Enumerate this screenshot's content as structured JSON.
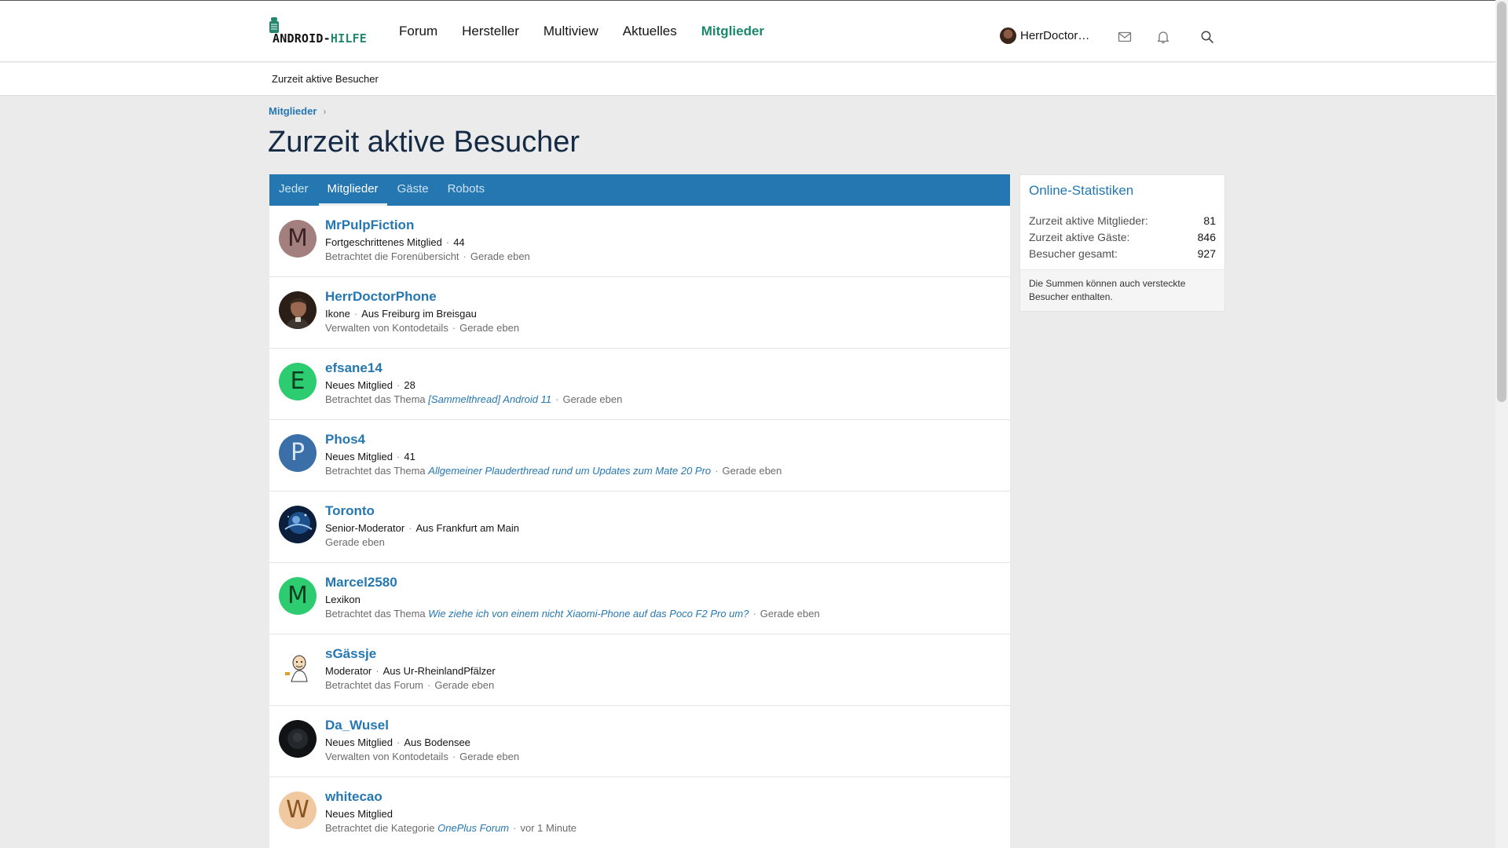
{
  "header": {
    "logo_text_main": "ANDROID-",
    "logo_text_accent": "HILFE",
    "nav": [
      {
        "label": "Forum",
        "active": false
      },
      {
        "label": "Hersteller",
        "active": false
      },
      {
        "label": "Multiview",
        "active": false
      },
      {
        "label": "Aktuelles",
        "active": false
      },
      {
        "label": "Mitglieder",
        "active": true
      }
    ],
    "user_name": "HerrDoctor…",
    "icons": [
      "mail-icon",
      "bell-icon",
      "search-icon"
    ]
  },
  "subnav": {
    "item": "Zurzeit aktive Besucher"
  },
  "breadcrumb": {
    "item": "Mitglieder",
    "separator": "›"
  },
  "page": {
    "title": "Zurzeit aktive Besucher"
  },
  "tabs": [
    {
      "label": "Jeder",
      "active": false
    },
    {
      "label": "Mitglieder",
      "active": true
    },
    {
      "label": "Gäste",
      "active": false
    },
    {
      "label": "Robots",
      "active": false
    }
  ],
  "members": [
    {
      "name": "MrPulpFiction",
      "avatar_type": "letter",
      "letter": "M",
      "avatar_bg": "#a37f7f",
      "avatar_fg": "#3d2424",
      "meta1": [
        "Fortgeschrittenes Mitglied",
        "44"
      ],
      "activity": "Betrachtet die Forenübersicht",
      "activity_link": "",
      "time": "Gerade eben"
    },
    {
      "name": "HerrDoctorPhone",
      "avatar_type": "photo-man",
      "meta1": [
        "Ikone",
        "Aus Freiburg im Breisgau"
      ],
      "activity": "Verwalten von Kontodetails",
      "activity_link": "",
      "time": "Gerade eben"
    },
    {
      "name": "efsane14",
      "avatar_type": "letter",
      "letter": "E",
      "avatar_bg": "#2ecc71",
      "avatar_fg": "#0d3d20",
      "meta1": [
        "Neues Mitglied",
        "28"
      ],
      "activity": "Betrachtet das Thema",
      "activity_link": "[Sammelthread] Android 11",
      "time": "Gerade eben"
    },
    {
      "name": "Phos4",
      "avatar_type": "letter",
      "letter": "P",
      "avatar_bg": "#3a6fa8",
      "avatar_fg": "#d7e6f5",
      "meta1": [
        "Neues Mitglied",
        "41"
      ],
      "activity": "Betrachtet das Thema",
      "activity_link": "Allgemeiner Plauderthread rund um Updates zum Mate 20 Pro",
      "time": "Gerade eben"
    },
    {
      "name": "Toronto",
      "avatar_type": "photo-space",
      "meta1": [
        "Senior-Moderator",
        "Aus Frankfurt am Main"
      ],
      "activity": "",
      "activity_link": "",
      "time": "Gerade eben"
    },
    {
      "name": "Marcel2580",
      "avatar_type": "letter",
      "letter": "M",
      "avatar_bg": "#2ecc71",
      "avatar_fg": "#0d3d20",
      "meta1": [
        "Lexikon"
      ],
      "activity": "Betrachtet das Thema",
      "activity_link": "Wie ziehe ich von einem nicht Xiaomi-Phone auf das Poco F2 Pro um?",
      "time": "Gerade eben"
    },
    {
      "name": "sGässje",
      "avatar_type": "photo-cartoon",
      "meta1": [
        "Moderator",
        "Aus Ur-RheinlandPfälzer"
      ],
      "activity": "Betrachtet das Forum",
      "activity_link": "",
      "time": "Gerade eben"
    },
    {
      "name": "Da_Wusel",
      "avatar_type": "photo-dark",
      "meta1": [
        "Neues Mitglied",
        "Aus Bodensee"
      ],
      "activity": "Verwalten von Kontodetails",
      "activity_link": "",
      "time": "Gerade eben"
    },
    {
      "name": "whitecao",
      "avatar_type": "letter",
      "letter": "W",
      "avatar_bg": "#f0c9a0",
      "avatar_fg": "#8a5422",
      "meta1": [
        "Neues Mitglied"
      ],
      "activity": "Betrachtet die Kategorie",
      "activity_link": "OnePlus Forum",
      "time": "vor 1 Minute"
    }
  ],
  "sidebar": {
    "title": "Online-Statistiken",
    "rows": [
      {
        "label": "Zurzeit aktive Mitglieder:",
        "value": "81"
      },
      {
        "label": "Zurzeit aktive Gäste:",
        "value": "846"
      },
      {
        "label": "Besucher gesamt:",
        "value": "927"
      }
    ],
    "note": "Die Summen können auch versteckte Besucher enthalten."
  }
}
